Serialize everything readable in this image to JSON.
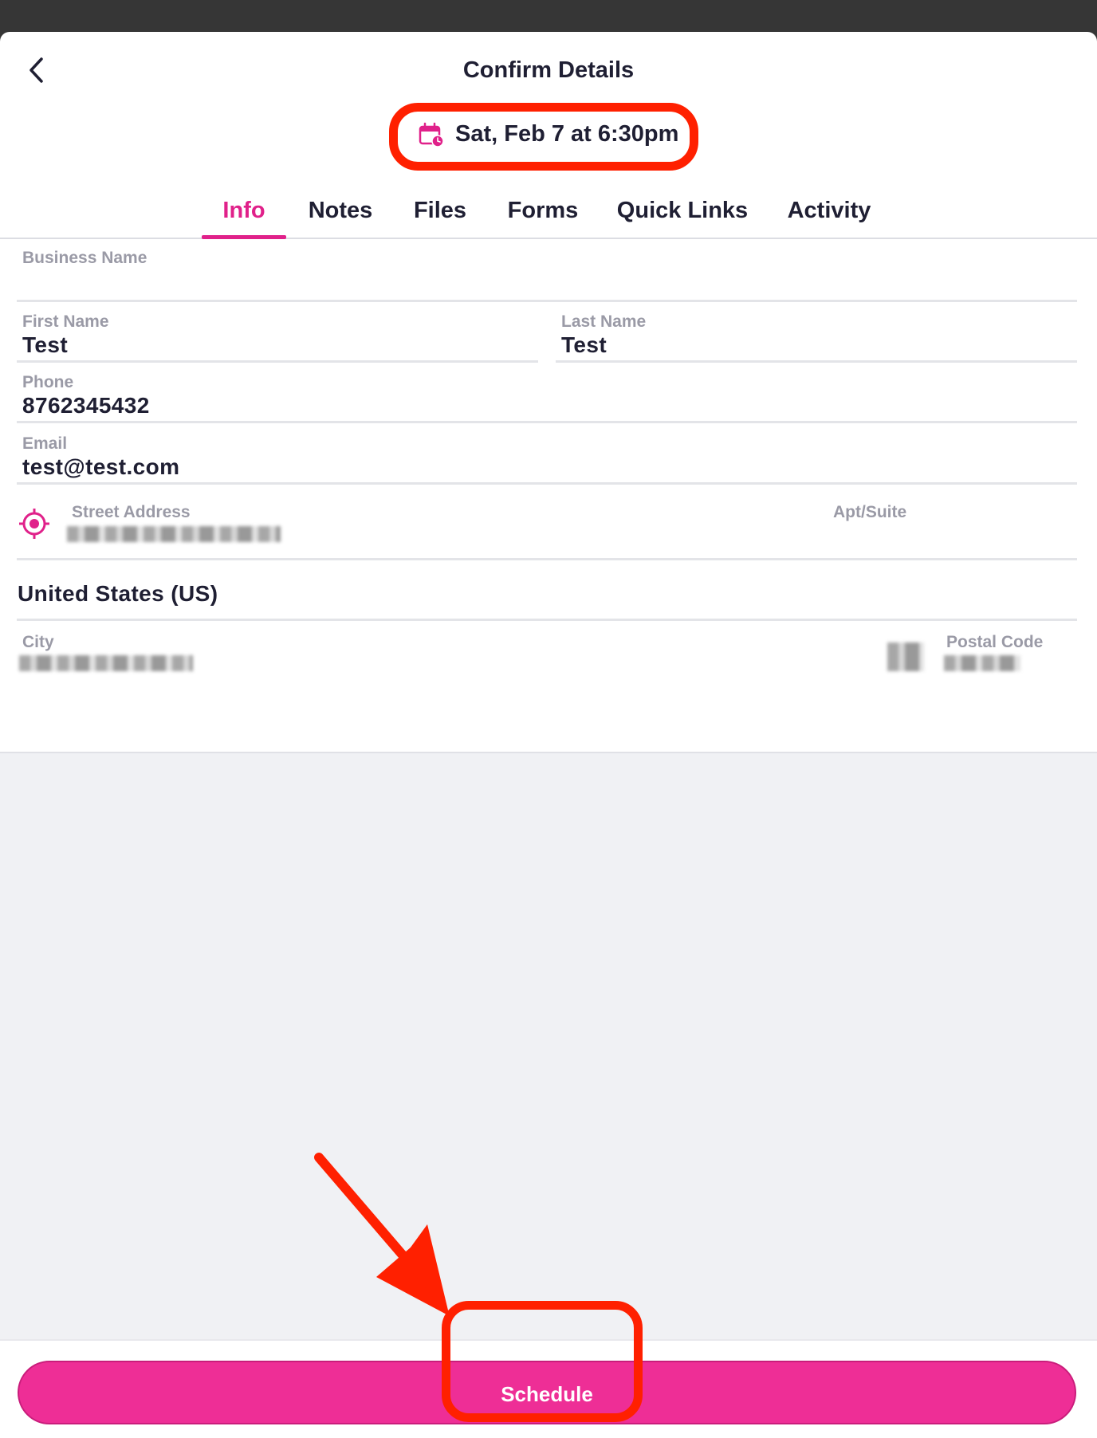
{
  "header": {
    "title": "Confirm Details",
    "date_label": "Sat, Feb 7 at 6:30pm",
    "back_icon": "chevron-left-icon",
    "calendar_icon": "calendar-clock-icon"
  },
  "tabs": [
    {
      "label": "Info",
      "active": true
    },
    {
      "label": "Notes",
      "active": false
    },
    {
      "label": "Files",
      "active": false
    },
    {
      "label": "Forms",
      "active": false
    },
    {
      "label": "Quick Links",
      "active": false
    },
    {
      "label": "Activity",
      "active": false
    }
  ],
  "form": {
    "business_name": {
      "label": "Business Name",
      "value": ""
    },
    "first_name": {
      "label": "First Name",
      "value": "Test"
    },
    "last_name": {
      "label": "Last Name",
      "value": "Test"
    },
    "phone": {
      "label": "Phone",
      "value": "8762345432"
    },
    "email": {
      "label": "Email",
      "value": "test@test.com"
    },
    "street_address": {
      "label": "Street Address"
    },
    "apt_suite": {
      "label": "Apt/Suite"
    },
    "country": {
      "value": "United States (US)"
    },
    "city": {
      "label": "City"
    },
    "postal_code": {
      "label": "Postal Code"
    },
    "location_icon": "location-target-icon"
  },
  "footer": {
    "schedule_label": "Schedule"
  },
  "colors": {
    "accent": "#e0218a",
    "button": "#ee2e96",
    "annotation": "#ff2000"
  }
}
